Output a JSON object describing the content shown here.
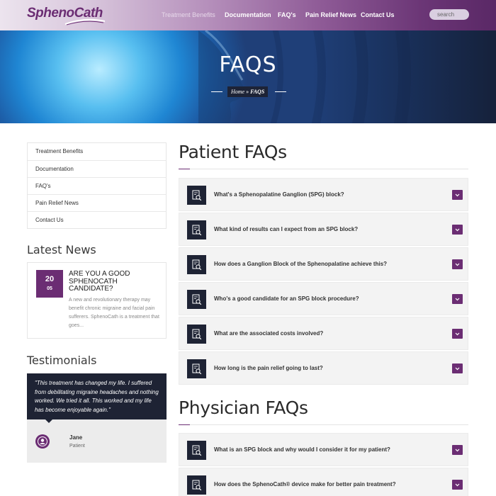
{
  "brand": {
    "name": "SphenoCath",
    "color": "#6b2d73"
  },
  "nav": {
    "items": [
      {
        "label": "Treatment Benefits",
        "active": true
      },
      {
        "label": "Documentation",
        "active": false
      },
      {
        "label": "FAQ's",
        "active": false
      },
      {
        "label": "Pain Relief News",
        "active": false
      },
      {
        "label": "Contact Us",
        "active": false
      }
    ],
    "search_placeholder": "search"
  },
  "hero": {
    "title": "FAQS",
    "breadcrumb": {
      "home": "Home",
      "separator": "»",
      "current": "FAQS"
    }
  },
  "sidebar": {
    "menu": [
      "Treatment Benefits",
      "Documentation",
      "FAQ's",
      "Pain Relief News",
      "Contact Us"
    ],
    "latest_news": {
      "heading": "Latest News",
      "post": {
        "day": "20",
        "month": "05",
        "title": "Are you a good SphenoCath candidate?",
        "excerpt": "A new and revolutionary therapy may benefit chronic migraine and facial pain sufferers. SphenoCath is a treatment that goes..."
      }
    },
    "testimonials": {
      "heading": "Testimonials",
      "quote": "\"This treatment has changed my life. I suffered from debilitating migraine headaches and nothing worked. We tried it all. This worked and my life has become enjoyable again.\"",
      "name": "Jane",
      "role": "Patient"
    }
  },
  "patient_faqs": {
    "heading": "Patient FAQs",
    "items": [
      "What's a Sphenopalatine Ganglion (SPG) block?",
      "What kind of results can I expect from an SPG block?",
      "How does a Ganglion Block of the Sphenopalatine achieve this?",
      "Who's a good candidate for an SPG block procedure?",
      "What are the associated costs involved?",
      "How long is the pain relief going to last?"
    ]
  },
  "physician_faqs": {
    "heading": "Physician FAQs",
    "items": [
      "What is an SPG block and why would I consider it for my patient?",
      "How does the SphenoCath® device make for better pain treatment?"
    ]
  },
  "icons": {
    "faq": "document-search-icon",
    "toggle": "chevron-down-icon",
    "avatar": "user-icon"
  }
}
